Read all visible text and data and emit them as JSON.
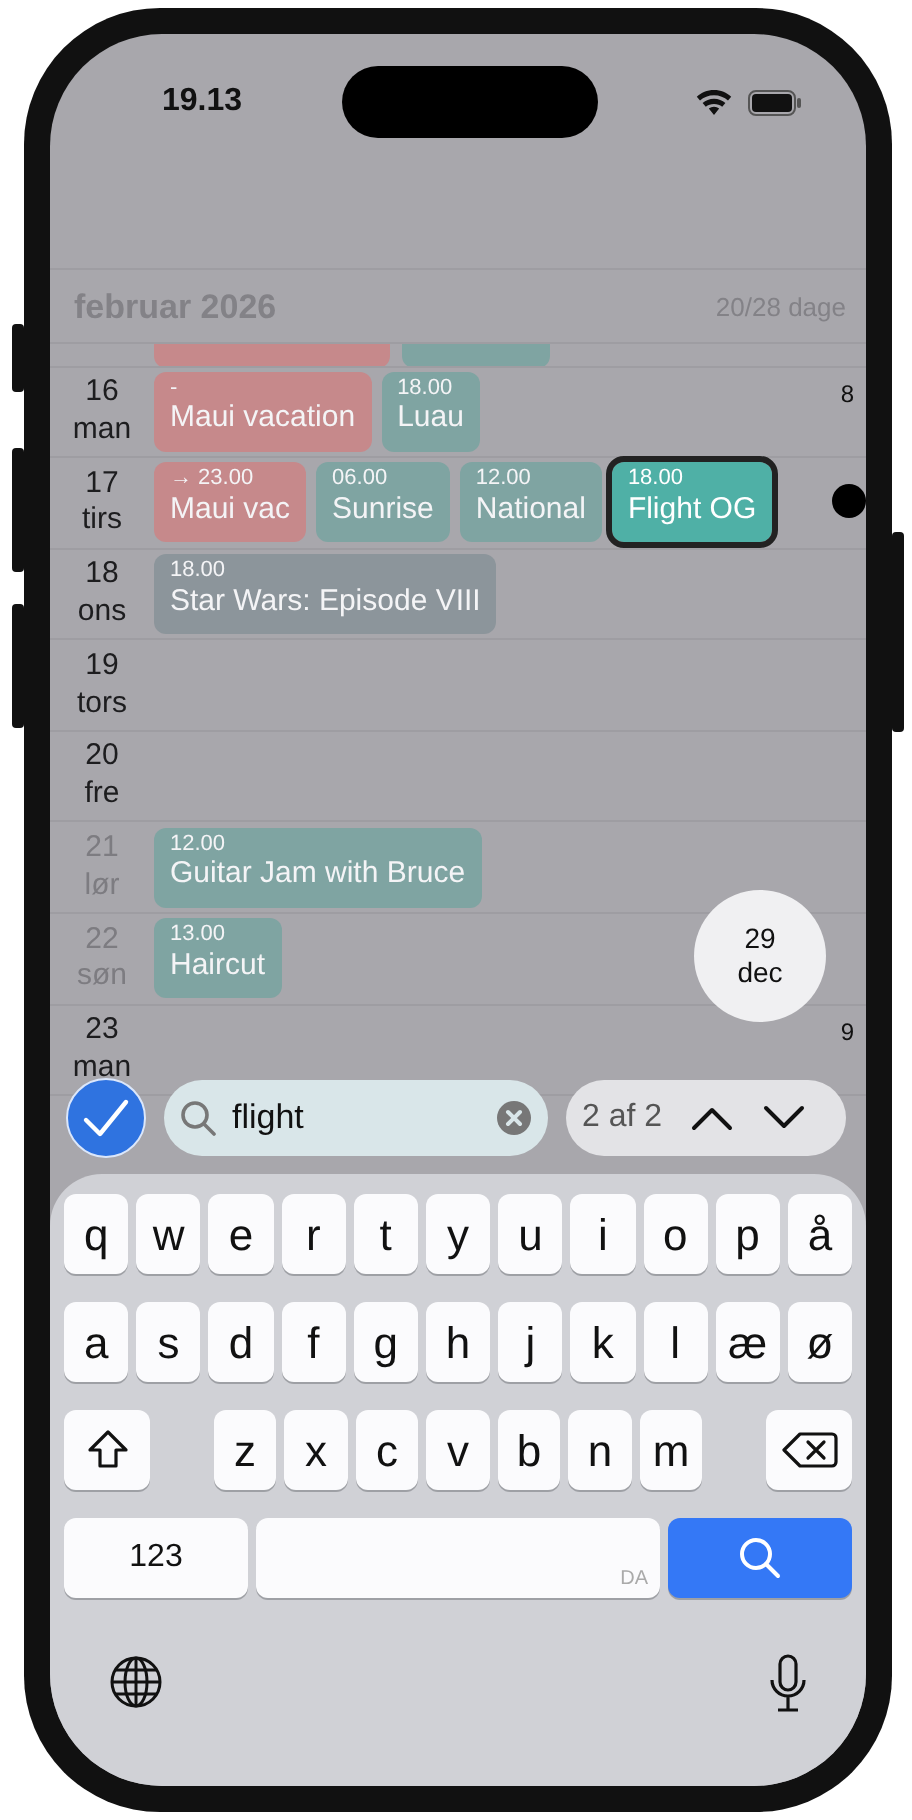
{
  "status_bar": {
    "time": "19.13"
  },
  "header": {
    "month": "februar 2026",
    "count": "20/28 dage"
  },
  "days": [
    {
      "day": "16",
      "weekday": "man",
      "weekend": false,
      "week": "8",
      "indicator": false,
      "events": [
        {
          "time": "-",
          "title": "Maui vacation",
          "color": "#c6898b",
          "selected": false
        },
        {
          "time": "18.00",
          "title": "Luau",
          "color": "#7fa4a2",
          "selected": false
        }
      ]
    },
    {
      "day": "17",
      "weekday": "tirs",
      "weekend": false,
      "indicator": true,
      "events": [
        {
          "time": "→ 23.00",
          "title": "Maui vac",
          "color": "#c6898b",
          "selected": false
        },
        {
          "time": "06.00",
          "title": "Sunrise",
          "color": "#7fa4a2",
          "selected": false
        },
        {
          "time": "12.00",
          "title": "National",
          "color": "#7fa4a2",
          "selected": false
        },
        {
          "time": "18.00",
          "title": "Flight OG",
          "color": "#4fb0a6",
          "selected": true
        }
      ]
    },
    {
      "day": "18",
      "weekday": "ons",
      "weekend": false,
      "indicator": false,
      "events": [
        {
          "time": "18.00",
          "title": "Star Wars: Episode VIII",
          "color": "#8c959b",
          "selected": false
        }
      ]
    },
    {
      "day": "19",
      "weekday": "tors",
      "weekend": false,
      "indicator": false
    },
    {
      "day": "20",
      "weekday": "fre",
      "weekend": false,
      "indicator": false
    },
    {
      "day": "21",
      "weekday": "lør",
      "weekend": true,
      "indicator": false,
      "events": [
        {
          "time": "12.00",
          "title": "Guitar Jam with Bruce",
          "color": "#7fa4a2",
          "selected": false
        }
      ]
    },
    {
      "day": "22",
      "weekday": "søn",
      "weekend": true,
      "indicator": false,
      "events": [
        {
          "time": "13.00",
          "title": "Haircut",
          "color": "#7fa4a2",
          "selected": false
        }
      ]
    },
    {
      "day": "23",
      "weekday": "man",
      "weekend": false,
      "week": "9",
      "indicator": false
    }
  ],
  "date_bubble": {
    "day": "29",
    "month": "dec"
  },
  "search": {
    "value": "flight",
    "matches": "2 af 2"
  },
  "keyboard": {
    "rows": [
      [
        {
          "kind": "letter",
          "label": "q"
        },
        {
          "kind": "letter",
          "label": "w"
        },
        {
          "kind": "letter",
          "label": "e"
        },
        {
          "kind": "letter",
          "label": "r"
        },
        {
          "kind": "letter",
          "label": "t"
        },
        {
          "kind": "letter",
          "label": "y"
        },
        {
          "kind": "letter",
          "label": "u"
        },
        {
          "kind": "letter",
          "label": "i"
        },
        {
          "kind": "letter",
          "label": "o"
        },
        {
          "kind": "letter",
          "label": "p"
        },
        {
          "kind": "letter",
          "label": "å"
        }
      ],
      [
        {
          "kind": "letter",
          "label": "a"
        },
        {
          "kind": "letter",
          "label": "s"
        },
        {
          "kind": "letter",
          "label": "d"
        },
        {
          "kind": "letter",
          "label": "f"
        },
        {
          "kind": "letter",
          "label": "g"
        },
        {
          "kind": "letter",
          "label": "h"
        },
        {
          "kind": "letter",
          "label": "j"
        },
        {
          "kind": "letter",
          "label": "k"
        },
        {
          "kind": "letter",
          "label": "l"
        },
        {
          "kind": "letter",
          "label": "æ"
        },
        {
          "kind": "letter",
          "label": "ø"
        }
      ]
    ],
    "third_row": [
      {
        "kind": "shift"
      },
      {
        "kind": "letter",
        "label": "z"
      },
      {
        "kind": "letter",
        "label": "x"
      },
      {
        "kind": "letter",
        "label": "c"
      },
      {
        "kind": "letter",
        "label": "v"
      },
      {
        "kind": "letter",
        "label": "b"
      },
      {
        "kind": "letter",
        "label": "n"
      },
      {
        "kind": "letter",
        "label": "m"
      },
      {
        "kind": "backspace"
      }
    ],
    "function_row": [
      {
        "kind": "numbers",
        "label": "123"
      },
      {
        "kind": "space",
        "label": "DA"
      },
      {
        "kind": "search"
      }
    ]
  }
}
